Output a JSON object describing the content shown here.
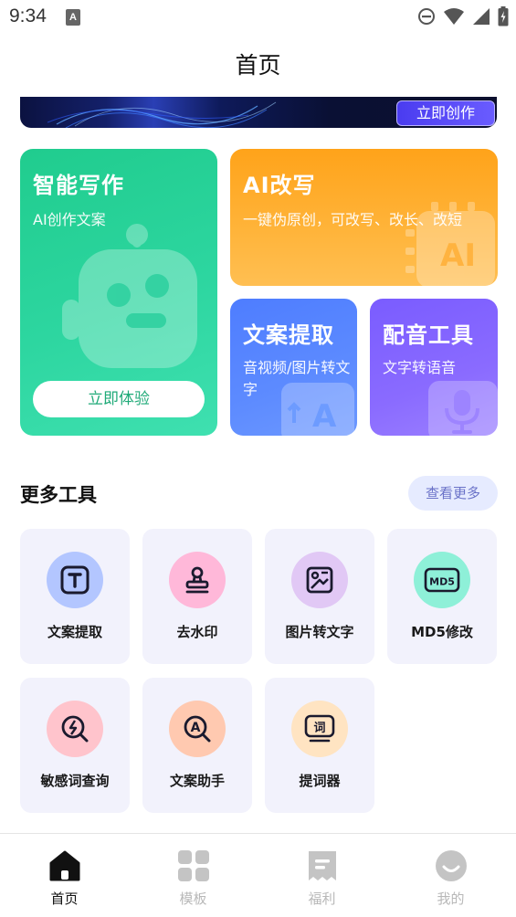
{
  "status": {
    "time": "9:34"
  },
  "header": {
    "title": "首页"
  },
  "banner": {
    "button_label": "立即创作"
  },
  "feature_cards": {
    "writing": {
      "title": "智能写作",
      "subtitle": "AI创作文案",
      "button_label": "立即体验"
    },
    "rewrite": {
      "title": "AI改写",
      "subtitle": "一键伪原创，可改写、改长、改短"
    },
    "extract": {
      "title": "文案提取",
      "subtitle": "音视频/图片转文字"
    },
    "dubbing": {
      "title": "配音工具",
      "subtitle": "文字转语音"
    }
  },
  "more_tools": {
    "title": "更多工具",
    "view_more": "查看更多",
    "items": [
      {
        "label": "文案提取",
        "icon": "text-t-icon",
        "color": "#b3c6ff"
      },
      {
        "label": "去水印",
        "icon": "stamp-icon",
        "color": "#ffb8d9"
      },
      {
        "label": "图片转文字",
        "icon": "image-text-icon",
        "color": "#e1c8f5"
      },
      {
        "label": "MD5修改",
        "icon": "md5-icon",
        "color": "#8ef0d8"
      },
      {
        "label": "敏感词查询",
        "icon": "sensitive-search-icon",
        "color": "#ffc4cc"
      },
      {
        "label": "文案助手",
        "icon": "assistant-search-icon",
        "color": "#ffc9b0"
      },
      {
        "label": "提词器",
        "icon": "teleprompter-icon",
        "color": "#ffe4c2"
      }
    ]
  },
  "tabbar": {
    "items": [
      {
        "label": "首页",
        "icon": "home-icon",
        "active": true
      },
      {
        "label": "模板",
        "icon": "template-grid-icon",
        "active": false
      },
      {
        "label": "福利",
        "icon": "welfare-receipt-icon",
        "active": false
      },
      {
        "label": "我的",
        "icon": "profile-smile-icon",
        "active": false
      }
    ]
  },
  "colors": {
    "accent_green": "#20cc8e",
    "accent_orange": "#ffa31a",
    "accent_blue": "#4e7dff",
    "accent_purple": "#7a5cff",
    "tab_active": "#111111",
    "tab_inactive": "#b8b8b8"
  }
}
